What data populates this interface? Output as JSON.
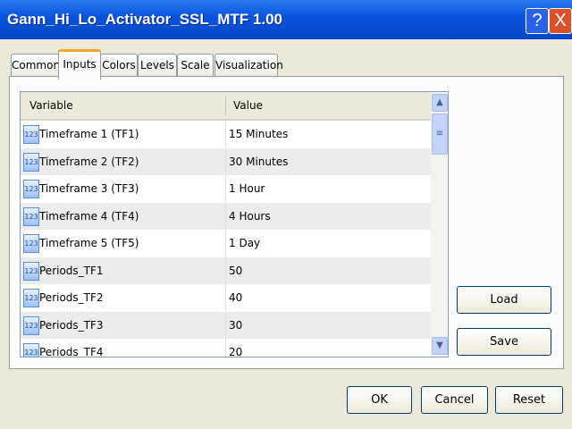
{
  "window": {
    "title": "Gann_Hi_Lo_Activator_SSL_MTF 1.00",
    "help": "?",
    "close": "X"
  },
  "tabs": [
    {
      "label": "Common"
    },
    {
      "label": "Inputs"
    },
    {
      "label": "Colors"
    },
    {
      "label": "Levels"
    },
    {
      "label": "Scale"
    },
    {
      "label": "Visualization"
    }
  ],
  "table": {
    "headers": {
      "variable": "Variable",
      "value": "Value"
    },
    "icon_text": "123",
    "rows": [
      {
        "variable": "Timeframe 1 (TF1)",
        "value": "15 Minutes"
      },
      {
        "variable": "Timeframe 2 (TF2)",
        "value": "30 Minutes"
      },
      {
        "variable": "Timeframe 3 (TF3)",
        "value": "1 Hour"
      },
      {
        "variable": "Timeframe 4 (TF4)",
        "value": "4 Hours"
      },
      {
        "variable": "Timeframe 5 (TF5)",
        "value": "1 Day"
      },
      {
        "variable": "Periods_TF1",
        "value": "50"
      },
      {
        "variable": "Periods_TF2",
        "value": "40"
      },
      {
        "variable": "Periods_TF3",
        "value": "30"
      },
      {
        "variable": "Periods_TF4",
        "value": "20"
      }
    ]
  },
  "buttons": {
    "load": "Load",
    "save": "Save",
    "ok": "OK",
    "cancel": "Cancel",
    "reset": "Reset"
  }
}
